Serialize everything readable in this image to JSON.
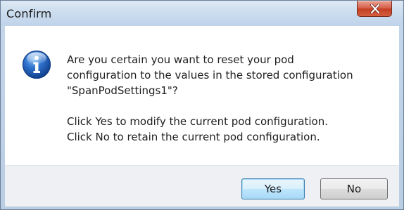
{
  "window": {
    "title": "Confirm",
    "close_icon": "close-icon"
  },
  "message": {
    "icon": "info-icon",
    "question": "Are you certain you want to reset your pod\nconfiguration to the values in the stored configuration\n\"SpanPodSettings1\"?",
    "instructions": "Click Yes to modify the current pod configuration.\nClick No to retain the current pod configuration."
  },
  "buttons": {
    "yes_label": "Yes",
    "no_label": "No"
  },
  "colors": {
    "close_button": "#c7432a",
    "info_icon": "#1f5fb8",
    "default_button_border": "#3c7fb1"
  }
}
